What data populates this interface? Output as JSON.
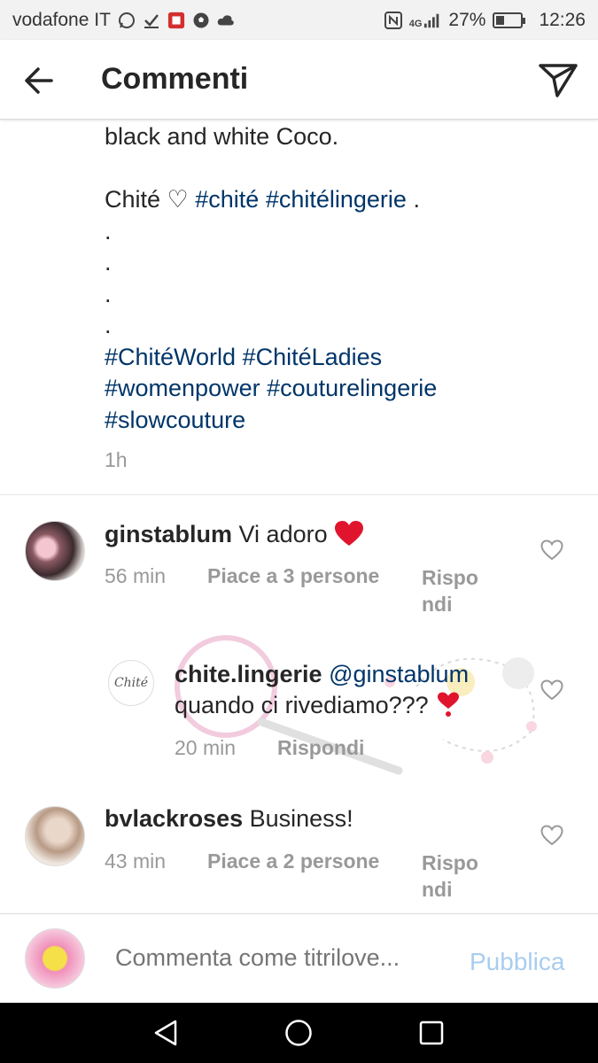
{
  "status": {
    "carrier": "vodafone IT",
    "network": "4G",
    "battery": "27%",
    "time": "12:26"
  },
  "header": {
    "title": "Commenti"
  },
  "caption": {
    "line1": "black and white Coco.",
    "line2_text": "Chité ♡ ",
    "line2_tag1": "#chité",
    "line2_tag2": "#chitélingerie",
    "line2_end": " .",
    "dots": ".",
    "tags_line1": "#ChitéWorld #ChitéLadies",
    "tags_line2": "#womenpower #couturelingerie",
    "tags_line3": "#slowcouture",
    "time": "1h"
  },
  "comments": [
    {
      "username": "ginstablum",
      "text": "Vi adoro",
      "emoji": "❤️",
      "time": "56 min",
      "likes": "Piace a 3 persone",
      "reply": "Rispo",
      "reply2": "ndi"
    },
    {
      "username": "chite.lingerie",
      "avatar_text": "Chité",
      "mention": "@ginstablum",
      "text": "quando ci rivediamo???",
      "emoji": "❣️",
      "time": "20 min",
      "reply": "Rispondi"
    },
    {
      "username": "bvlackroses",
      "text": "Business!",
      "time": "43 min",
      "likes": "Piace a 2 persone",
      "reply": "Rispo",
      "reply2": "ndi"
    }
  ],
  "composer": {
    "placeholder": "Commenta come titrilove...",
    "publish": "Pubblica"
  },
  "colors": {
    "hashtag": "#003569",
    "meta": "#999999",
    "publish": "#a8cdf0",
    "heart": "#e0152d"
  }
}
